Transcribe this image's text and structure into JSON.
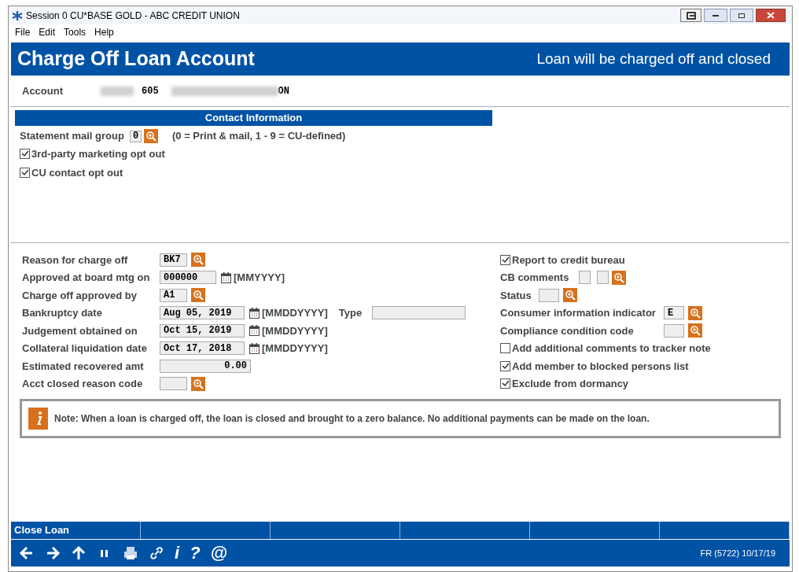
{
  "window": {
    "title": "Session 0 CU*BASE GOLD - ABC CREDIT UNION"
  },
  "menu": [
    "File",
    "Edit",
    "Tools",
    "Help"
  ],
  "header": {
    "title": "Charge Off Loan Account",
    "subtitle": "Loan will be charged off and closed"
  },
  "account": {
    "label": "Account",
    "number": "605",
    "suffix": "ON"
  },
  "contact": {
    "title": "Contact Information",
    "mail_group": {
      "label": "Statement mail group",
      "value": "0",
      "hint": "(0 = Print & mail, 1 - 9 = CU-defined)"
    },
    "options": [
      {
        "label": "3rd-party marketing opt out",
        "checked": true
      },
      {
        "label": "CU contact opt out",
        "checked": true
      }
    ]
  },
  "left_fields": [
    {
      "kind": "code",
      "label": "Reason for charge off",
      "value": "BK7"
    },
    {
      "kind": "month",
      "label": "Approved at board mtg on",
      "value": "000000",
      "format": "[MMYYYY]"
    },
    {
      "kind": "code",
      "label": "Charge off approved by",
      "value": "A1"
    },
    {
      "kind": "date",
      "label": "Bankruptcy date",
      "value": "Aug 05, 2019",
      "format": "[MMDDYYYY]",
      "extra_label": "Type"
    },
    {
      "kind": "date",
      "label": "Judgement obtained on",
      "value": "Oct 15, 2019",
      "format": "[MMDDYYYY]"
    },
    {
      "kind": "date",
      "label": "Collateral liquidation date",
      "value": "Oct 17, 2018",
      "format": "[MMDDYYYY]"
    },
    {
      "kind": "amount",
      "label": "Estimated recovered amt",
      "value": "0.00"
    },
    {
      "kind": "code",
      "label": "Acct closed reason code"
    }
  ],
  "right_fields": [
    {
      "kind": "checkbox",
      "label": "Report to credit bureau",
      "checked": true
    },
    {
      "kind": "double_code",
      "label": "CB comments"
    },
    {
      "kind": "code",
      "label": "Status"
    },
    {
      "kind": "wide_code",
      "label": "Consumer information indicator",
      "value": "E"
    },
    {
      "kind": "wide_code",
      "label": "Compliance condition code"
    },
    {
      "kind": "checkbox",
      "label": "Add additional comments to tracker note",
      "checked": false
    },
    {
      "kind": "checkbox",
      "label": "Add member to blocked persons list",
      "checked": true
    },
    {
      "kind": "checkbox",
      "label": "Exclude from dormancy",
      "checked": true
    }
  ],
  "note": "Note: When a loan is charged off, the loan is closed and brought to a zero balance. No additional payments can be made on the loan.",
  "actions": [
    "Close Loan"
  ],
  "toolbar": [
    {
      "kind": "back"
    },
    {
      "kind": "forward"
    },
    {
      "kind": "up"
    },
    {
      "kind": "pause"
    },
    {
      "kind": "print"
    },
    {
      "kind": "link"
    },
    {
      "kind": "glyph",
      "glyph": "i"
    },
    {
      "kind": "glyph",
      "glyph": "?"
    },
    {
      "kind": "glyph",
      "glyph": "@"
    }
  ],
  "status": "FR (5722) 10/17/19"
}
